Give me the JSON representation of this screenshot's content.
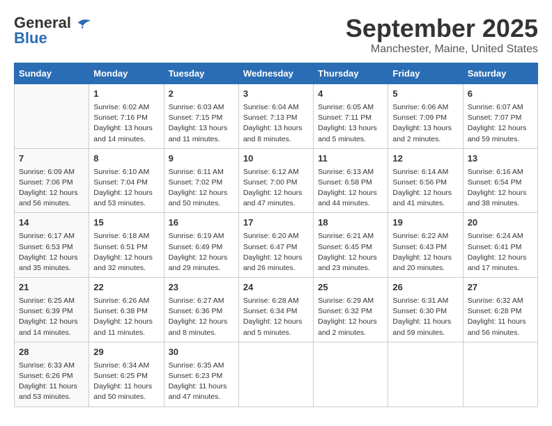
{
  "header": {
    "logo_general": "General",
    "logo_blue": "Blue",
    "month": "September 2025",
    "location": "Manchester, Maine, United States"
  },
  "days_of_week": [
    "Sunday",
    "Monday",
    "Tuesday",
    "Wednesday",
    "Thursday",
    "Friday",
    "Saturday"
  ],
  "weeks": [
    [
      {
        "day": "",
        "content": ""
      },
      {
        "day": "1",
        "content": "Sunrise: 6:02 AM\nSunset: 7:16 PM\nDaylight: 13 hours\nand 14 minutes."
      },
      {
        "day": "2",
        "content": "Sunrise: 6:03 AM\nSunset: 7:15 PM\nDaylight: 13 hours\nand 11 minutes."
      },
      {
        "day": "3",
        "content": "Sunrise: 6:04 AM\nSunset: 7:13 PM\nDaylight: 13 hours\nand 8 minutes."
      },
      {
        "day": "4",
        "content": "Sunrise: 6:05 AM\nSunset: 7:11 PM\nDaylight: 13 hours\nand 5 minutes."
      },
      {
        "day": "5",
        "content": "Sunrise: 6:06 AM\nSunset: 7:09 PM\nDaylight: 13 hours\nand 2 minutes."
      },
      {
        "day": "6",
        "content": "Sunrise: 6:07 AM\nSunset: 7:07 PM\nDaylight: 12 hours\nand 59 minutes."
      }
    ],
    [
      {
        "day": "7",
        "content": "Sunrise: 6:09 AM\nSunset: 7:06 PM\nDaylight: 12 hours\nand 56 minutes."
      },
      {
        "day": "8",
        "content": "Sunrise: 6:10 AM\nSunset: 7:04 PM\nDaylight: 12 hours\nand 53 minutes."
      },
      {
        "day": "9",
        "content": "Sunrise: 6:11 AM\nSunset: 7:02 PM\nDaylight: 12 hours\nand 50 minutes."
      },
      {
        "day": "10",
        "content": "Sunrise: 6:12 AM\nSunset: 7:00 PM\nDaylight: 12 hours\nand 47 minutes."
      },
      {
        "day": "11",
        "content": "Sunrise: 6:13 AM\nSunset: 6:58 PM\nDaylight: 12 hours\nand 44 minutes."
      },
      {
        "day": "12",
        "content": "Sunrise: 6:14 AM\nSunset: 6:56 PM\nDaylight: 12 hours\nand 41 minutes."
      },
      {
        "day": "13",
        "content": "Sunrise: 6:16 AM\nSunset: 6:54 PM\nDaylight: 12 hours\nand 38 minutes."
      }
    ],
    [
      {
        "day": "14",
        "content": "Sunrise: 6:17 AM\nSunset: 6:53 PM\nDaylight: 12 hours\nand 35 minutes."
      },
      {
        "day": "15",
        "content": "Sunrise: 6:18 AM\nSunset: 6:51 PM\nDaylight: 12 hours\nand 32 minutes."
      },
      {
        "day": "16",
        "content": "Sunrise: 6:19 AM\nSunset: 6:49 PM\nDaylight: 12 hours\nand 29 minutes."
      },
      {
        "day": "17",
        "content": "Sunrise: 6:20 AM\nSunset: 6:47 PM\nDaylight: 12 hours\nand 26 minutes."
      },
      {
        "day": "18",
        "content": "Sunrise: 6:21 AM\nSunset: 6:45 PM\nDaylight: 12 hours\nand 23 minutes."
      },
      {
        "day": "19",
        "content": "Sunrise: 6:22 AM\nSunset: 6:43 PM\nDaylight: 12 hours\nand 20 minutes."
      },
      {
        "day": "20",
        "content": "Sunrise: 6:24 AM\nSunset: 6:41 PM\nDaylight: 12 hours\nand 17 minutes."
      }
    ],
    [
      {
        "day": "21",
        "content": "Sunrise: 6:25 AM\nSunset: 6:39 PM\nDaylight: 12 hours\nand 14 minutes."
      },
      {
        "day": "22",
        "content": "Sunrise: 6:26 AM\nSunset: 6:38 PM\nDaylight: 12 hours\nand 11 minutes."
      },
      {
        "day": "23",
        "content": "Sunrise: 6:27 AM\nSunset: 6:36 PM\nDaylight: 12 hours\nand 8 minutes."
      },
      {
        "day": "24",
        "content": "Sunrise: 6:28 AM\nSunset: 6:34 PM\nDaylight: 12 hours\nand 5 minutes."
      },
      {
        "day": "25",
        "content": "Sunrise: 6:29 AM\nSunset: 6:32 PM\nDaylight: 12 hours\nand 2 minutes."
      },
      {
        "day": "26",
        "content": "Sunrise: 6:31 AM\nSunset: 6:30 PM\nDaylight: 11 hours\nand 59 minutes."
      },
      {
        "day": "27",
        "content": "Sunrise: 6:32 AM\nSunset: 6:28 PM\nDaylight: 11 hours\nand 56 minutes."
      }
    ],
    [
      {
        "day": "28",
        "content": "Sunrise: 6:33 AM\nSunset: 6:26 PM\nDaylight: 11 hours\nand 53 minutes."
      },
      {
        "day": "29",
        "content": "Sunrise: 6:34 AM\nSunset: 6:25 PM\nDaylight: 11 hours\nand 50 minutes."
      },
      {
        "day": "30",
        "content": "Sunrise: 6:35 AM\nSunset: 6:23 PM\nDaylight: 11 hours\nand 47 minutes."
      },
      {
        "day": "",
        "content": ""
      },
      {
        "day": "",
        "content": ""
      },
      {
        "day": "",
        "content": ""
      },
      {
        "day": "",
        "content": ""
      }
    ]
  ]
}
